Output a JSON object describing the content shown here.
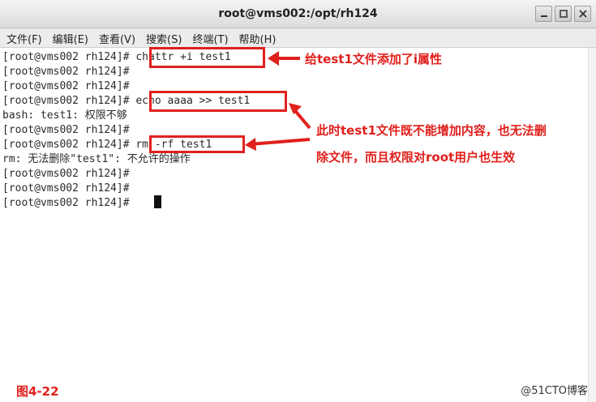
{
  "window": {
    "title": "root@vms002:/opt/rh124",
    "buttons": [
      "_",
      "□",
      "×"
    ]
  },
  "menu": [
    "文件(F)",
    "编辑(E)",
    "查看(V)",
    "搜索(S)",
    "终端(T)",
    "帮助(H)"
  ],
  "terminal": {
    "lines": [
      "[root@vms002 rh124]# chattr +i test1",
      "[root@vms002 rh124]#",
      "[root@vms002 rh124]#",
      "[root@vms002 rh124]# echo aaaa >> test1",
      "bash: test1: 权限不够",
      "[root@vms002 rh124]#",
      "[root@vms002 rh124]# rm -rf test1",
      "rm: 无法删除\"test1\": 不允许的操作",
      "[root@vms002 rh124]#",
      "[root@vms002 rh124]#",
      "[root@vms002 rh124]#"
    ]
  },
  "annotations": {
    "note1": "给test1文件添加了i属性",
    "note2_line1": "此时test1文件既不能增加内容，也无法删",
    "note2_line2": "除文件，而且权限对root用户也生效",
    "figure_label": "图4-22",
    "watermark": "@51CTO博客"
  },
  "colors": {
    "annotation_red": "#e0201c",
    "terminal_bg": "#ffffff"
  }
}
